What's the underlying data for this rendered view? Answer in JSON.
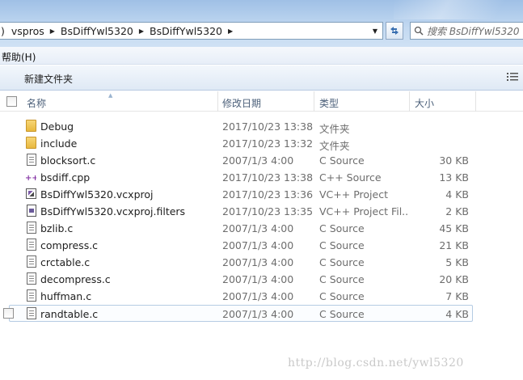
{
  "address_bar": {
    "breadcrumbs": [
      ")",
      "vspros",
      "BsDiffYwl5320",
      "BsDiffYwl5320"
    ],
    "search_placeholder": "搜索 BsDiffYwl5320"
  },
  "menu": {
    "items": [
      "帮助(H)"
    ]
  },
  "command_bar": {
    "new_folder": "新建文件夹"
  },
  "columns": {
    "name": "名称",
    "date": "修改日期",
    "type": "类型",
    "size": "大小"
  },
  "files": [
    {
      "name": "Debug",
      "date": "2017/10/23 13:38",
      "type": "文件夹",
      "size": "",
      "icon": "folder-icon"
    },
    {
      "name": "include",
      "date": "2017/10/23 13:32",
      "type": "文件夹",
      "size": "",
      "icon": "folder-icon"
    },
    {
      "name": "blocksort.c",
      "date": "2007/1/3 4:00",
      "type": "C Source",
      "size": "30 KB",
      "icon": "c-source-icon"
    },
    {
      "name": "bsdiff.cpp",
      "date": "2017/10/23 13:38",
      "type": "C++ Source",
      "size": "13 KB",
      "icon": "cpp-source-icon"
    },
    {
      "name": "BsDiffYwl5320.vcxproj",
      "date": "2017/10/23 13:36",
      "type": "VC++ Project",
      "size": "4 KB",
      "icon": "vcxproj-icon"
    },
    {
      "name": "BsDiffYwl5320.vcxproj.filters",
      "date": "2017/10/23 13:35",
      "type": "VC++ Project Fil...",
      "size": "2 KB",
      "icon": "filters-icon"
    },
    {
      "name": "bzlib.c",
      "date": "2007/1/3 4:00",
      "type": "C Source",
      "size": "45 KB",
      "icon": "c-source-icon"
    },
    {
      "name": "compress.c",
      "date": "2007/1/3 4:00",
      "type": "C Source",
      "size": "21 KB",
      "icon": "c-source-icon"
    },
    {
      "name": "crctable.c",
      "date": "2007/1/3 4:00",
      "type": "C Source",
      "size": "5 KB",
      "icon": "c-source-icon"
    },
    {
      "name": "decompress.c",
      "date": "2007/1/3 4:00",
      "type": "C Source",
      "size": "20 KB",
      "icon": "c-source-icon"
    },
    {
      "name": "huffman.c",
      "date": "2007/1/3 4:00",
      "type": "C Source",
      "size": "7 KB",
      "icon": "c-source-icon"
    },
    {
      "name": "randtable.c",
      "date": "2007/1/3 4:00",
      "type": "C Source",
      "size": "4 KB",
      "icon": "c-source-icon",
      "selected": true
    }
  ],
  "watermark": "http://blog.csdn.net/ywl5320"
}
